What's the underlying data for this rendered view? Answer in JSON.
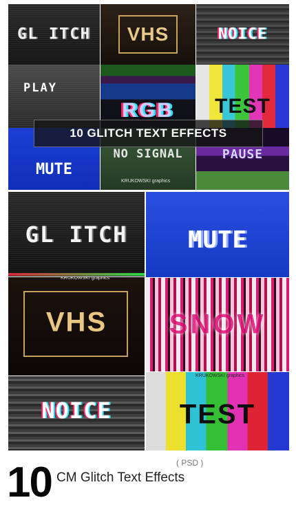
{
  "top_collage": {
    "glitch": "GL ITCH",
    "vhs": "VHS",
    "noice": "NOICE",
    "play": "PLAY",
    "rgb": "RGB",
    "test": "TEST",
    "mute": "MUTE",
    "no_signal": "NO SIGNAL",
    "pause": "PAUSE",
    "banner": "10 GLITCH TEXT EFFECTS",
    "watermark": "KRUKOWSKI graphics"
  },
  "bottom_collage": {
    "glitch": "GL ITCH",
    "mute": "MUTE",
    "vhs": "VHS",
    "snow": "SNOW",
    "noice": "NOICE",
    "test": "TEST",
    "watermark": "KRUKOWSKI graphics"
  },
  "footer": {
    "number": "10",
    "tag": "( PSD )",
    "title": "CM Glitch Text Effects"
  },
  "colors": {
    "gold": "#c9a35a",
    "blue": "#1d3fd4",
    "magenta": "#d81a72"
  }
}
